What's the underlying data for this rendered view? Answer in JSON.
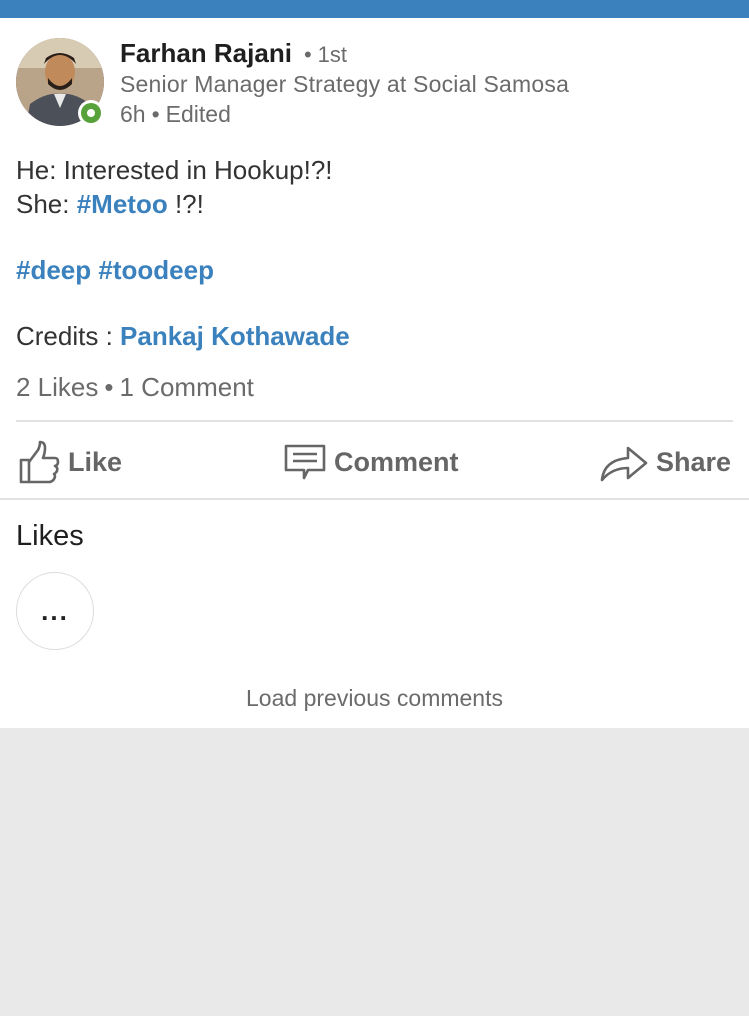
{
  "post": {
    "author": {
      "name": "Farhan Rajani",
      "connection_degree": "1st",
      "headline": "Senior Manager Strategy at Social Samosa",
      "time": "6h",
      "edited_label": "Edited",
      "online": true
    },
    "content": {
      "line1": "He: Interested in Hookup!?!",
      "line2_prefix": "She: ",
      "line2_hashtag": "#Metoo",
      "line2_suffix": " !?!",
      "hashtag1": "#deep",
      "hashtag2": "#toodeep",
      "credits_label": "Credits : ",
      "credits_name": "Pankaj Kothawade"
    },
    "stats": {
      "likes": "2 Likes",
      "separator": "•",
      "comments": "1 Comment"
    },
    "actions": {
      "like": "Like",
      "comment": "Comment",
      "share": "Share"
    }
  },
  "likes_section": {
    "title": "Likes",
    "more_label": "..."
  },
  "comments": {
    "load_previous": "Load previous comments"
  },
  "colors": {
    "top_bar": "#3a81bd",
    "link": "#3a81bd",
    "presence": "#57a23a",
    "background": "#e9e9e9"
  }
}
